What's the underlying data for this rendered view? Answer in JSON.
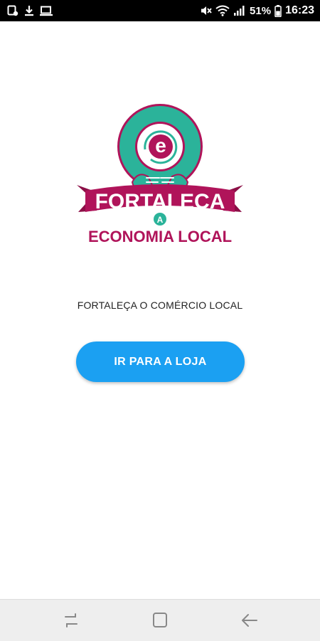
{
  "status_bar": {
    "left_icons": [
      "screenshot-icon",
      "download-icon",
      "cast-icon"
    ],
    "right_icons": [
      "mute-icon",
      "wifi-icon",
      "signal-icon",
      "battery-icon"
    ],
    "battery_percent": "51%",
    "time": "16:23"
  },
  "logo": {
    "letter": "e",
    "line1": "FORTALEÇA",
    "connector": "A",
    "line2": "ECONOMIA LOCAL",
    "colors": {
      "teal": "#2bb39a",
      "magenta": "#b0145a"
    }
  },
  "tagline": "FORTALEÇA O COMÉRCIO LOCAL",
  "shop_button": {
    "label": "IR PARA A LOJA",
    "color": "#1ba0f2"
  },
  "nav_bar": {
    "icons": [
      "recent-apps-icon",
      "home-icon",
      "back-icon"
    ]
  }
}
